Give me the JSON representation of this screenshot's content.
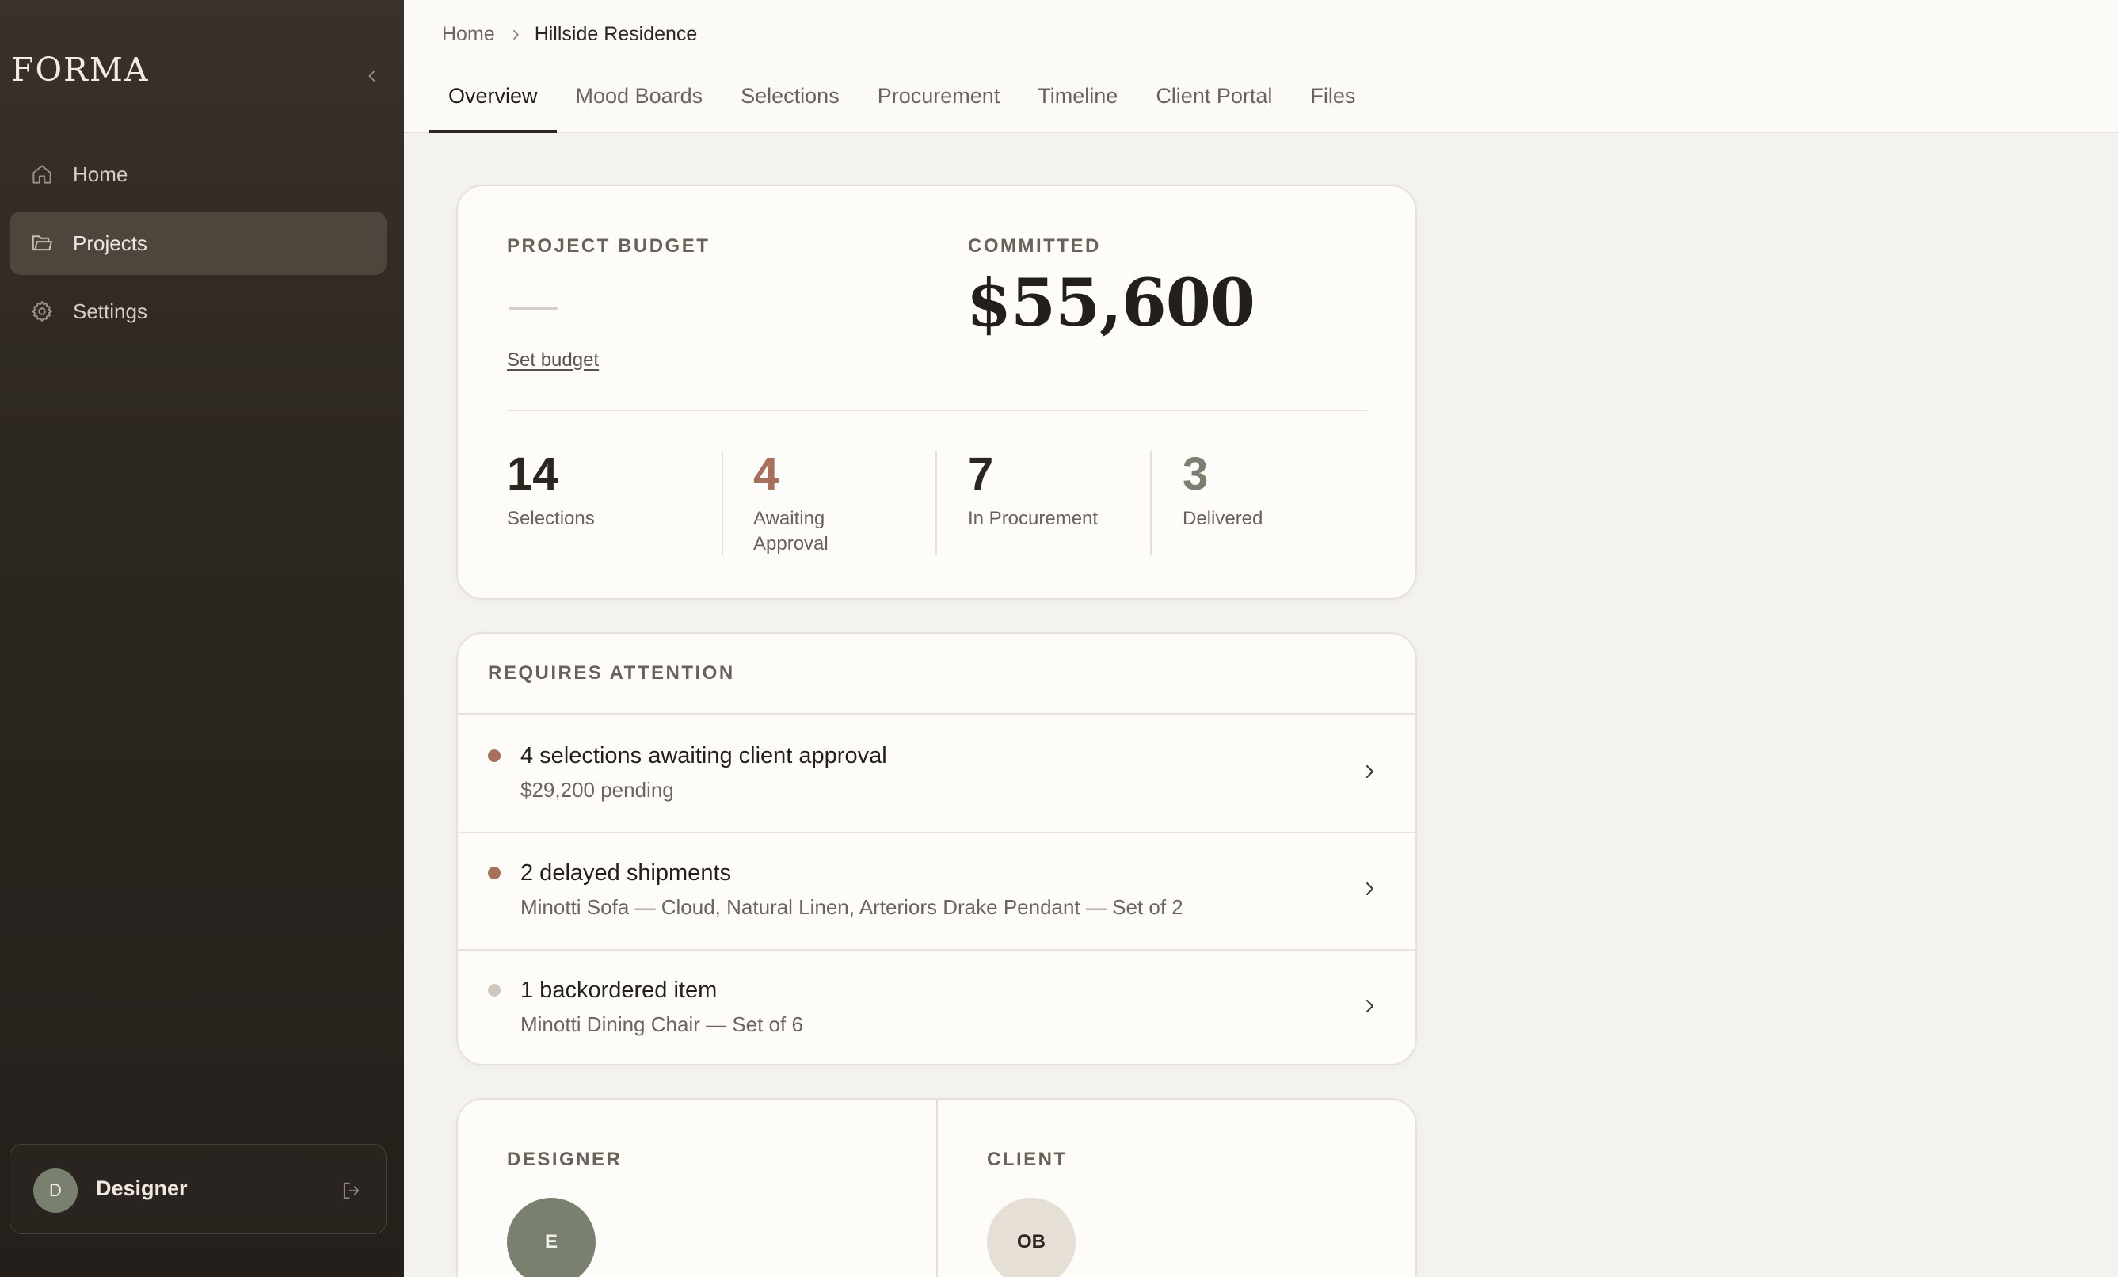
{
  "app": {
    "logo": "FORMA"
  },
  "colors": {
    "accent_terracotta": "#a8705b",
    "accent_sage": "#7a806f",
    "dot_muted": "#cfc7be",
    "sidebar_bg": "#2e2822"
  },
  "sidebar": {
    "collapse_icon": "chevron-left-icon",
    "items": [
      {
        "label": "Home",
        "icon": "house-icon",
        "active": false
      },
      {
        "label": "Projects",
        "icon": "folder-icon",
        "active": true
      },
      {
        "label": "Settings",
        "icon": "gear-icon",
        "active": false
      }
    ],
    "user": {
      "initial": "D",
      "name": "Designer",
      "logout_icon": "logout-icon"
    }
  },
  "breadcrumb": {
    "home": "Home",
    "current": "Hillside Residence"
  },
  "tabs": [
    {
      "label": "Overview",
      "active": true
    },
    {
      "label": "Mood Boards",
      "active": false
    },
    {
      "label": "Selections",
      "active": false
    },
    {
      "label": "Procurement",
      "active": false
    },
    {
      "label": "Timeline",
      "active": false
    },
    {
      "label": "Client Portal",
      "active": false
    },
    {
      "label": "Files",
      "active": false
    }
  ],
  "budget": {
    "budget_label": "PROJECT BUDGET",
    "set_budget_link": "Set budget",
    "committed_label": "COMMITTED",
    "committed_value": "$55,600",
    "stats": [
      {
        "value": "14",
        "caption": "Selections",
        "color": "#2b2620"
      },
      {
        "value": "4",
        "caption": "Awaiting Approval",
        "color": "#a8705b"
      },
      {
        "value": "7",
        "caption": "In Procurement",
        "color": "#2b2620"
      },
      {
        "value": "3",
        "caption": "Delivered",
        "color": "#7a806f"
      }
    ]
  },
  "attention": {
    "header": "REQUIRES ATTENTION",
    "items": [
      {
        "title": "4 selections awaiting client approval",
        "subtitle": "$29,200 pending",
        "dot_color": "#a8705b"
      },
      {
        "title": "2 delayed shipments",
        "subtitle": "Minotti Sofa — Cloud, Natural Linen, Arteriors Drake Pendant — Set of 2",
        "dot_color": "#a8705b"
      },
      {
        "title": "1 backordered item",
        "subtitle": "Minotti Dining Chair — Set of 6",
        "dot_color": "#cfc7be"
      }
    ]
  },
  "people": {
    "designer_label": "DESIGNER",
    "designer_initials": "E",
    "client_label": "CLIENT",
    "client_initials": "OB"
  }
}
